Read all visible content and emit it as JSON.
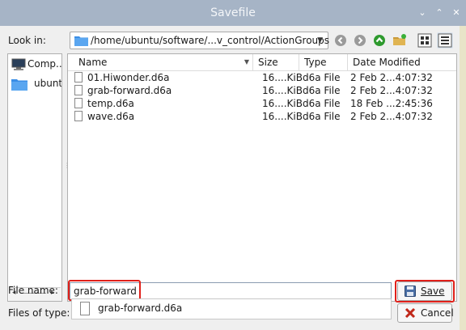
{
  "window": {
    "title": "Savefile",
    "buttons": {
      "minimize": "⌄",
      "maximize": "⌃",
      "close": "✕"
    }
  },
  "look_in": {
    "label": "Look in:",
    "path": "/home/ubuntu/software/...v_control/ActionGroups",
    "nav_icons": [
      "back-icon",
      "forward-icon",
      "parent-dir-icon",
      "new-folder-icon",
      "list-view-icon",
      "detail-view-icon"
    ]
  },
  "places": [
    {
      "label": "Comp...",
      "icon": "computer-icon"
    },
    {
      "label": "ubunt",
      "icon": "folder-icon"
    }
  ],
  "file_list": {
    "columns": [
      "Name",
      "Size",
      "Type",
      "Date Modified"
    ],
    "rows": [
      {
        "name": "01.Hiwonder.d6a",
        "size": "16....KiB",
        "type": "d6a File",
        "modified": "2 Feb 2...4:07:32"
      },
      {
        "name": "grab-forward.d6a",
        "size": "16....KiB",
        "type": "d6a File",
        "modified": "2 Feb 2...4:07:32"
      },
      {
        "name": "temp.d6a",
        "size": "16....KiB",
        "type": "d6a File",
        "modified": "18 Feb ...2:45:36"
      },
      {
        "name": "wave.d6a",
        "size": "16....KiB",
        "type": "d6a File",
        "modified": "2 Feb 2...4:07:32"
      }
    ]
  },
  "file_name": {
    "label": "File name:",
    "value": "grab-forward",
    "suggestion": "grab-forward.d6a"
  },
  "files_of_type": {
    "label": "Files of type:"
  },
  "buttons": {
    "save": "Save",
    "cancel": "Cancel"
  },
  "colors": {
    "titlebar": "#a6b4c6",
    "highlight": "#e0201a",
    "folder": "#3a8ee6"
  }
}
